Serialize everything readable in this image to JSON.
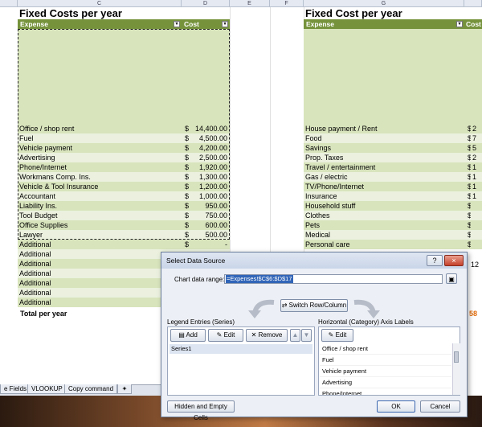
{
  "columns": [
    "C",
    "D",
    "E",
    "F",
    "G"
  ],
  "left_table": {
    "title": "Fixed Costs per year",
    "header_expense": "Expense",
    "header_cost": "Cost",
    "rows": [
      {
        "expense": "Office / shop rent",
        "cur": "$",
        "cost": "14,400.00"
      },
      {
        "expense": "Fuel",
        "cur": "$",
        "cost": "4,500.00"
      },
      {
        "expense": "Vehicle payment",
        "cur": "$",
        "cost": "4,200.00"
      },
      {
        "expense": "Advertising",
        "cur": "$",
        "cost": "2,500.00"
      },
      {
        "expense": "Phone/Internet",
        "cur": "$",
        "cost": "1,920.00"
      },
      {
        "expense": "Workmans Comp. Ins.",
        "cur": "$",
        "cost": "1,300.00"
      },
      {
        "expense": "Vehicle & Tool Insurance",
        "cur": "$",
        "cost": "1,200.00"
      },
      {
        "expense": "Accountant",
        "cur": "$",
        "cost": "1,000.00"
      },
      {
        "expense": "Liability Ins.",
        "cur": "$",
        "cost": "950.00"
      },
      {
        "expense": "Tool Budget",
        "cur": "$",
        "cost": "750.00"
      },
      {
        "expense": "Office Supplies",
        "cur": "$",
        "cost": "600.00"
      },
      {
        "expense": "Lawyer",
        "cur": "$",
        "cost": "500.00"
      },
      {
        "expense": "Additional",
        "cur": "$",
        "cost": "-"
      },
      {
        "expense": "Additional",
        "cur": "",
        "cost": ""
      },
      {
        "expense": "Additional",
        "cur": "",
        "cost": ""
      },
      {
        "expense": "Additional",
        "cur": "",
        "cost": ""
      },
      {
        "expense": "Additional",
        "cur": "",
        "cost": ""
      },
      {
        "expense": "Additional",
        "cur": "",
        "cost": ""
      },
      {
        "expense": "Additional",
        "cur": "",
        "cost": ""
      }
    ],
    "total_label": "Total per year"
  },
  "right_table": {
    "title": "Fixed Cost per year",
    "header_expense": "Expense",
    "header_cost": "Cost",
    "rows": [
      {
        "expense": "House payment / Rent",
        "cur": "$",
        "cost": "2"
      },
      {
        "expense": "Food",
        "cur": "$",
        "cost": "7"
      },
      {
        "expense": "Savings",
        "cur": "$",
        "cost": "5"
      },
      {
        "expense": "Prop. Taxes",
        "cur": "$",
        "cost": "2"
      },
      {
        "expense": "Travel / entertainment",
        "cur": "$",
        "cost": "1"
      },
      {
        "expense": "Gas / electric",
        "cur": "$",
        "cost": "1"
      },
      {
        "expense": "TV/Phone/Internet",
        "cur": "$",
        "cost": "1"
      },
      {
        "expense": "Insurance",
        "cur": "$",
        "cost": "1"
      },
      {
        "expense": "Household stuff",
        "cur": "$",
        "cost": ""
      },
      {
        "expense": "Clothes",
        "cur": "$",
        "cost": ""
      },
      {
        "expense": "Pets",
        "cur": "$",
        "cost": ""
      },
      {
        "expense": "Medical",
        "cur": "$",
        "cost": ""
      },
      {
        "expense": "Personal care",
        "cur": "$",
        "cost": ""
      }
    ],
    "partial_total": "12",
    "partial_total2": "58"
  },
  "sheet_tabs": [
    "e Fields",
    "VLOOKUP",
    "Copy command"
  ],
  "dialog": {
    "title": "Select Data Source",
    "help_glyph": "?",
    "close_glyph": "×",
    "chart_range_label": "Chart data range:",
    "chart_range_value": "=Expenses!$C$6:$D$17",
    "switch_label": "Switch Row/Column",
    "legend_label": "Legend Entries (Series)",
    "axis_label": "Horizontal (Category) Axis Labels",
    "add_label": "Add",
    "edit_label": "Edit",
    "remove_label": "Remove",
    "axis_edit_label": "Edit",
    "series": [
      "Series1"
    ],
    "axis_items": [
      "Office / shop rent",
      "Fuel",
      "Vehicle payment",
      "Advertising",
      "Phone/Internet"
    ],
    "hidden_cells_label": "Hidden and Empty Cells",
    "ok_label": "OK",
    "cancel_label": "Cancel"
  },
  "colors": {
    "header_green": "#76933c",
    "row_green_a": "#d8e4bc",
    "row_green_b": "#ebf1de",
    "total_accent": "#e26b0a"
  }
}
